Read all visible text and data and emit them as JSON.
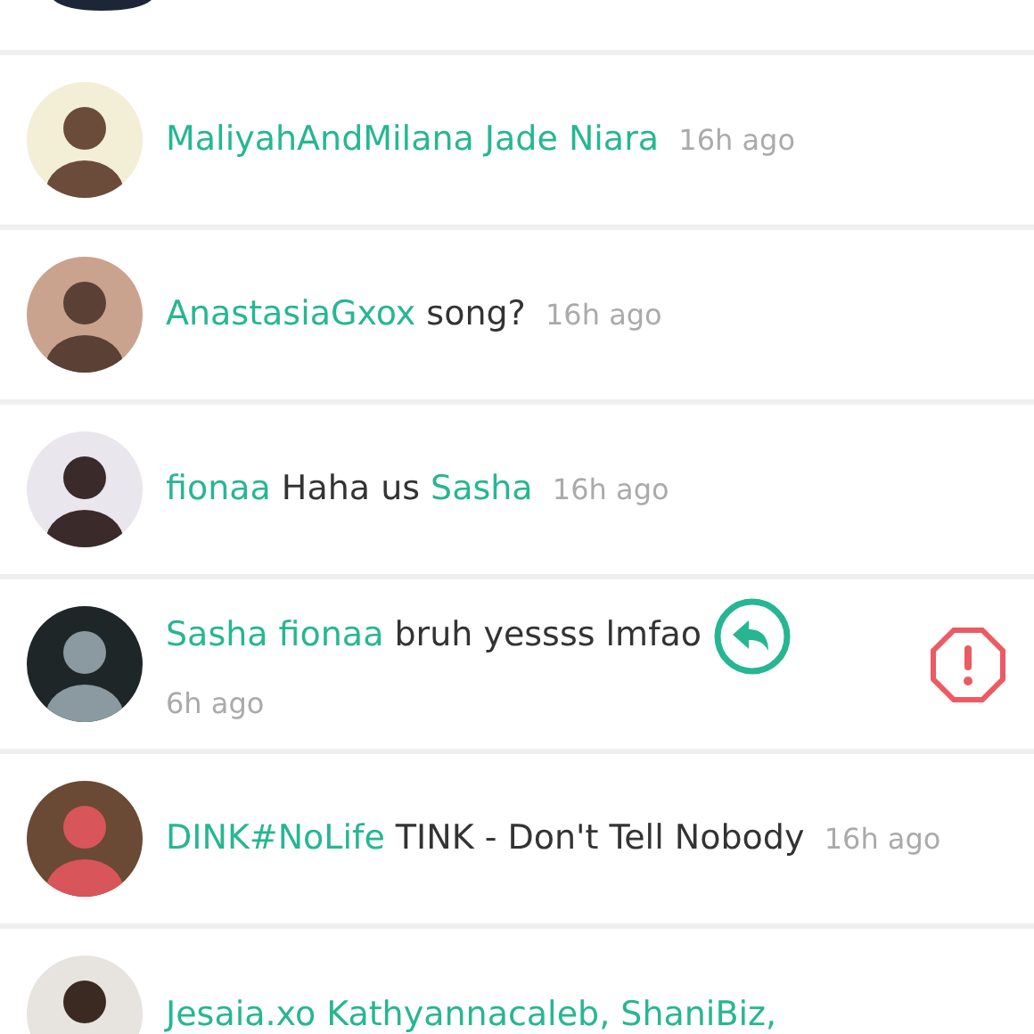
{
  "comments": [
    {
      "author": "MaliyahAndMilana",
      "body": [
        {
          "kind": "mention",
          "text": "Jade Niara"
        }
      ],
      "time": "16h ago",
      "actions_revealed": false
    },
    {
      "author": "AnastasiaGxox",
      "body": [
        {
          "kind": "text",
          "text": "song?"
        }
      ],
      "time": "16h ago",
      "actions_revealed": false
    },
    {
      "author": "fionaa",
      "body": [
        {
          "kind": "text",
          "text": "Haha us"
        },
        {
          "kind": "mention",
          "text": "Sasha"
        }
      ],
      "time": "16h ago",
      "actions_revealed": false
    },
    {
      "author": "Sasha",
      "body": [
        {
          "kind": "mention",
          "text": "fionaa"
        },
        {
          "kind": "text",
          "text": "bruh yessss lmfao"
        }
      ],
      "time": "6h ago",
      "actions_revealed": true
    },
    {
      "author": "DINK#NoLife",
      "body": [
        {
          "kind": "text",
          "text": "TINK - Don't Tell Nobody"
        }
      ],
      "time": "16h ago",
      "actions_revealed": false
    },
    {
      "author": "Jesaia.xo",
      "body": [
        {
          "kind": "mention",
          "text": "Kathyannacaleb,"
        },
        {
          "kind": "mention",
          "text": "ShaniBiz,"
        }
      ],
      "actions_revealed": false
    }
  ]
}
